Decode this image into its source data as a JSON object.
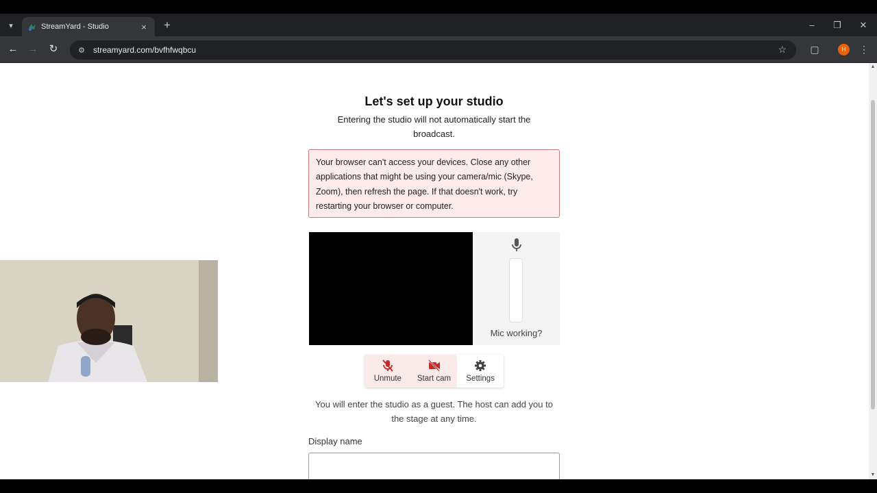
{
  "browser": {
    "tab_title": "StreamYard - Studio",
    "url": "streamyard.com/bvfhfwqbcu",
    "profile_initial": "H",
    "profile_color": "#e8620c"
  },
  "page": {
    "heading": "Let's set up your studio",
    "subheading": "Entering the studio will not automatically start the broadcast.",
    "alert": "Your browser can't access your devices. Close any other applications that might be using your camera/mic (Skype, Zoom), then refresh the page. If that doesn't work, try restarting your browser or computer.",
    "mic_working": "Mic working?",
    "controls": {
      "unmute": "Unmute",
      "start_cam": "Start cam",
      "settings": "Settings"
    },
    "guest_note": "You will enter the studio as a guest. The host can add you to the stage at any time.",
    "display_name_label": "Display name",
    "display_name_value": ""
  },
  "colors": {
    "alert_bg": "#fdeceb",
    "alert_border": "#c97b7b",
    "muted_red": "#c62828"
  }
}
